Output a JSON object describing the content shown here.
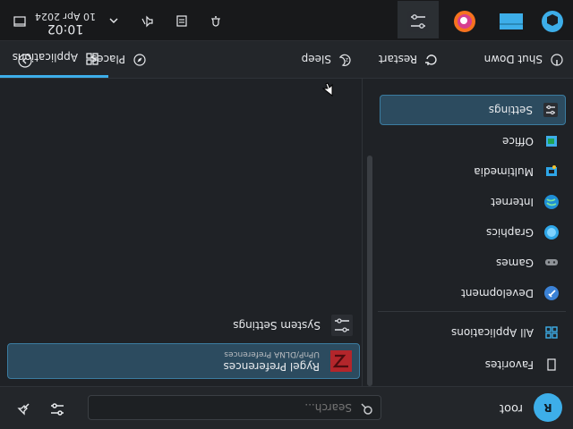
{
  "top": {
    "user_initial": "R",
    "username": "root",
    "search_placeholder": "Search..."
  },
  "left_categories": [
    {
      "label": "Favorites",
      "icon": "bookmark-icon"
    },
    {
      "label": "All Applications",
      "icon": "grid-icon"
    },
    {
      "label": "Development",
      "icon": "wrench-icon"
    },
    {
      "label": "Games",
      "icon": "gamepad-icon"
    },
    {
      "label": "Graphics",
      "icon": "graphics-icon"
    },
    {
      "label": "Internet",
      "icon": "globe-icon"
    },
    {
      "label": "Multimedia",
      "icon": "media-icon"
    },
    {
      "label": "Office",
      "icon": "office-icon"
    },
    {
      "label": "Settings",
      "icon": "settings-icon"
    }
  ],
  "right_list": {
    "items": [
      {
        "title": "Rygel Preferences",
        "subtitle": "UPnP/DLNA Preferences",
        "icon": "rygel-icon"
      },
      {
        "title": "System Settings",
        "subtitle": "",
        "icon": "settings-icon"
      }
    ]
  },
  "bottom": {
    "tabs": [
      {
        "label": "Applications",
        "icon": "grid-icon"
      },
      {
        "label": "Places",
        "icon": "compass-icon"
      }
    ],
    "actions": [
      {
        "label": "Sleep",
        "icon": "sleep-icon"
      },
      {
        "label": "Restart",
        "icon": "restart-icon"
      },
      {
        "label": "Shut Down",
        "icon": "power-icon"
      }
    ]
  },
  "taskbar": {
    "clock_time": "10:02",
    "clock_date": "10 Apr 2024"
  },
  "colors": {
    "accent": "#3daee9",
    "selected_bg": "#2c4b5f",
    "panel_bg": "#1f2226"
  }
}
